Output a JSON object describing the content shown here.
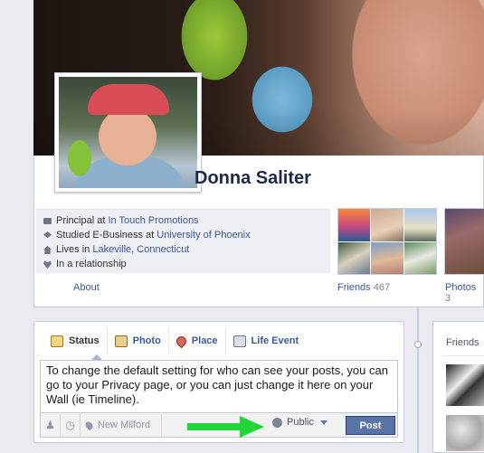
{
  "profile": {
    "name": "Donna Saliter",
    "info": [
      {
        "icon": "briefcase-icon",
        "prefix": "Principal at ",
        "link": "In Touch Promotions"
      },
      {
        "icon": "graduation-cap-icon",
        "prefix": "Studied E-Business at ",
        "link": "University of Phoenix"
      },
      {
        "icon": "house-icon",
        "prefix": "Lives in ",
        "link": "Lakeville, Connecticut"
      },
      {
        "icon": "heart-icon",
        "prefix": "In a relationship",
        "link": ""
      }
    ],
    "about_label": "About",
    "friends_label": "Friends",
    "friends_count": "467",
    "photos_label": "Photos",
    "photos_count": "3"
  },
  "composer": {
    "tabs": [
      {
        "label": "Status",
        "icon": "status-icon",
        "active": true
      },
      {
        "label": "Photo",
        "icon": "photo-icon",
        "active": false
      },
      {
        "label": "Place",
        "icon": "place-pin-icon",
        "active": false
      },
      {
        "label": "Life Event",
        "icon": "life-event-icon",
        "active": false
      }
    ],
    "text": "To change the default setting for who can see your posts, you can go to your Privacy page, or you can just change it here on your Wall (ie Timeline).",
    "location_placeholder": "New Milford",
    "privacy_label": "Public",
    "post_label": "Post"
  },
  "sidebar": {
    "friends_title": "Friends"
  },
  "colors": {
    "link": "#3b5998",
    "post_button": "#5b74a8",
    "arrow": "#22d63a"
  }
}
